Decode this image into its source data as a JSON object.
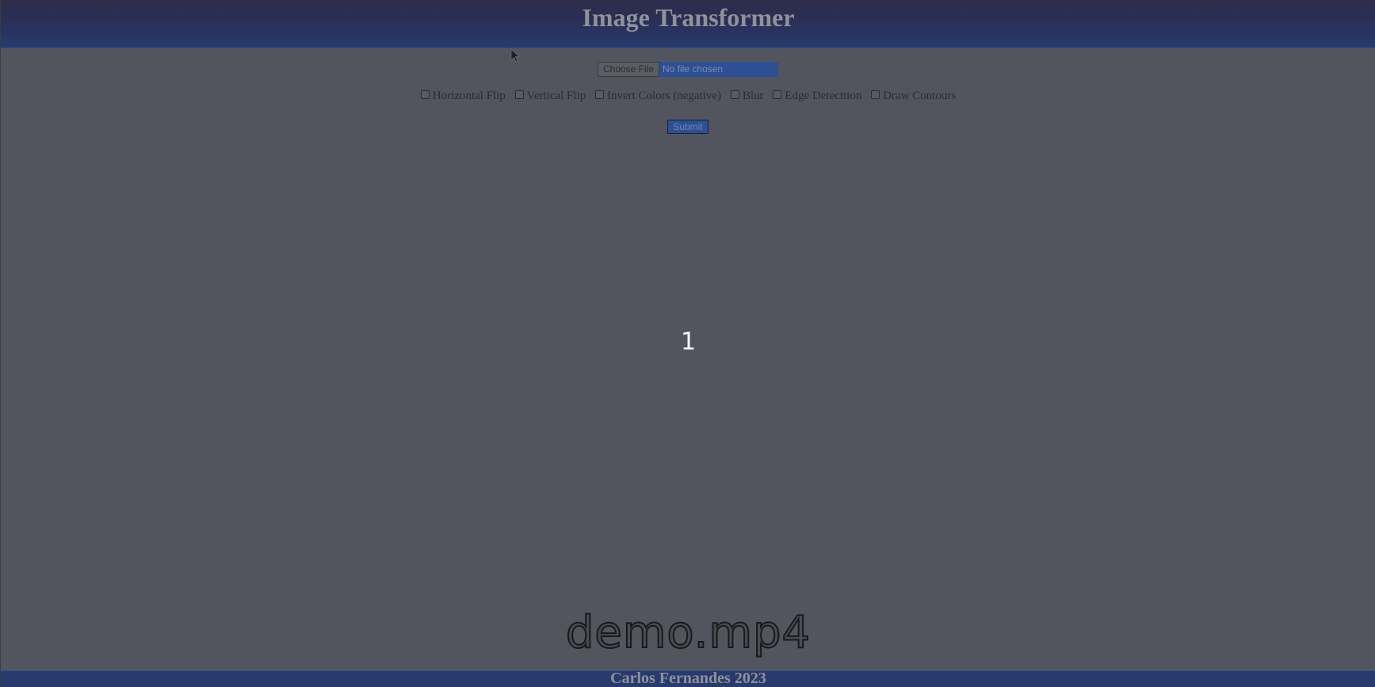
{
  "header": {
    "title": "Image Transformer"
  },
  "upload": {
    "choose_label": "Choose File",
    "status_text": "No file chosen"
  },
  "options": [
    {
      "label": "Horizontal Flip",
      "checked": false
    },
    {
      "label": "Vertical Flip",
      "checked": false
    },
    {
      "label": "Invert Colors (negative)",
      "checked": false
    },
    {
      "label": "Blur",
      "checked": false
    },
    {
      "label": "Edge Detecttion",
      "checked": false
    },
    {
      "label": "Draw Contours",
      "checked": false
    }
  ],
  "submit_label": "Submit",
  "overlay": {
    "countdown": "1",
    "video_name": "demo.mp4"
  },
  "footer": {
    "text": "Carlos Fernandes 2023"
  },
  "colors": {
    "page_bg": "#52555e",
    "header_bg": "#283a6e",
    "accent_blue": "#2c4f95",
    "text_gray": "#8f9298"
  }
}
